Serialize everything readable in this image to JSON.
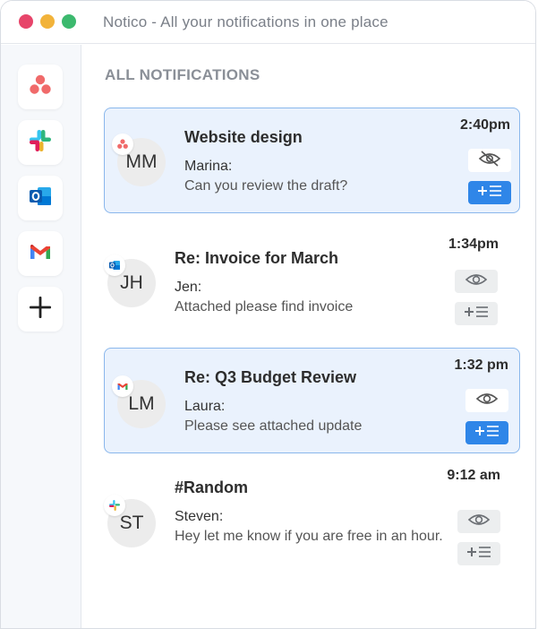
{
  "window": {
    "title": "Notico - All your notifications in one place"
  },
  "sidebar": {
    "apps": [
      {
        "name": "Asana",
        "icon": "asana-icon"
      },
      {
        "name": "Slack",
        "icon": "slack-icon"
      },
      {
        "name": "Outlook",
        "icon": "outlook-icon"
      },
      {
        "name": "Gmail",
        "icon": "gmail-icon"
      },
      {
        "name": "Add",
        "icon": "plus-icon"
      }
    ]
  },
  "main": {
    "heading": "ALL NOTIFICATIONS",
    "notifications": [
      {
        "source": "asana",
        "initials": "MM",
        "subject": "Website design",
        "sender": "Marina:",
        "message": "Can you review the draft?",
        "time": "2:40pm",
        "highlighted": true,
        "visibility": "hidden",
        "add_active": true
      },
      {
        "source": "outlook",
        "initials": "JH",
        "subject": "Re: Invoice for March",
        "sender": "Jen:",
        "message": "Attached please find invoice",
        "time": "1:34pm",
        "highlighted": false,
        "visibility": "visible",
        "add_active": false
      },
      {
        "source": "gmail",
        "initials": "LM",
        "subject": "Re: Q3 Budget Review",
        "sender": "Laura:",
        "message": "Please see attached update",
        "time": "1:32 pm",
        "highlighted": true,
        "visibility": "visible",
        "add_active": true
      },
      {
        "source": "slack",
        "initials": "ST",
        "subject": "#Random",
        "sender": "Steven:",
        "message": "Hey let me know if you are free in an hour.",
        "time": "9:12 am",
        "highlighted": false,
        "visibility": "visible",
        "add_active": false
      }
    ]
  },
  "colors": {
    "highlight_bg": "#eaf2fd",
    "highlight_border": "#8ab7ec",
    "accent_blue": "#2f86e8",
    "dot_red": "#e7456a",
    "dot_yellow": "#f2b33a",
    "dot_green": "#3cb96e"
  }
}
